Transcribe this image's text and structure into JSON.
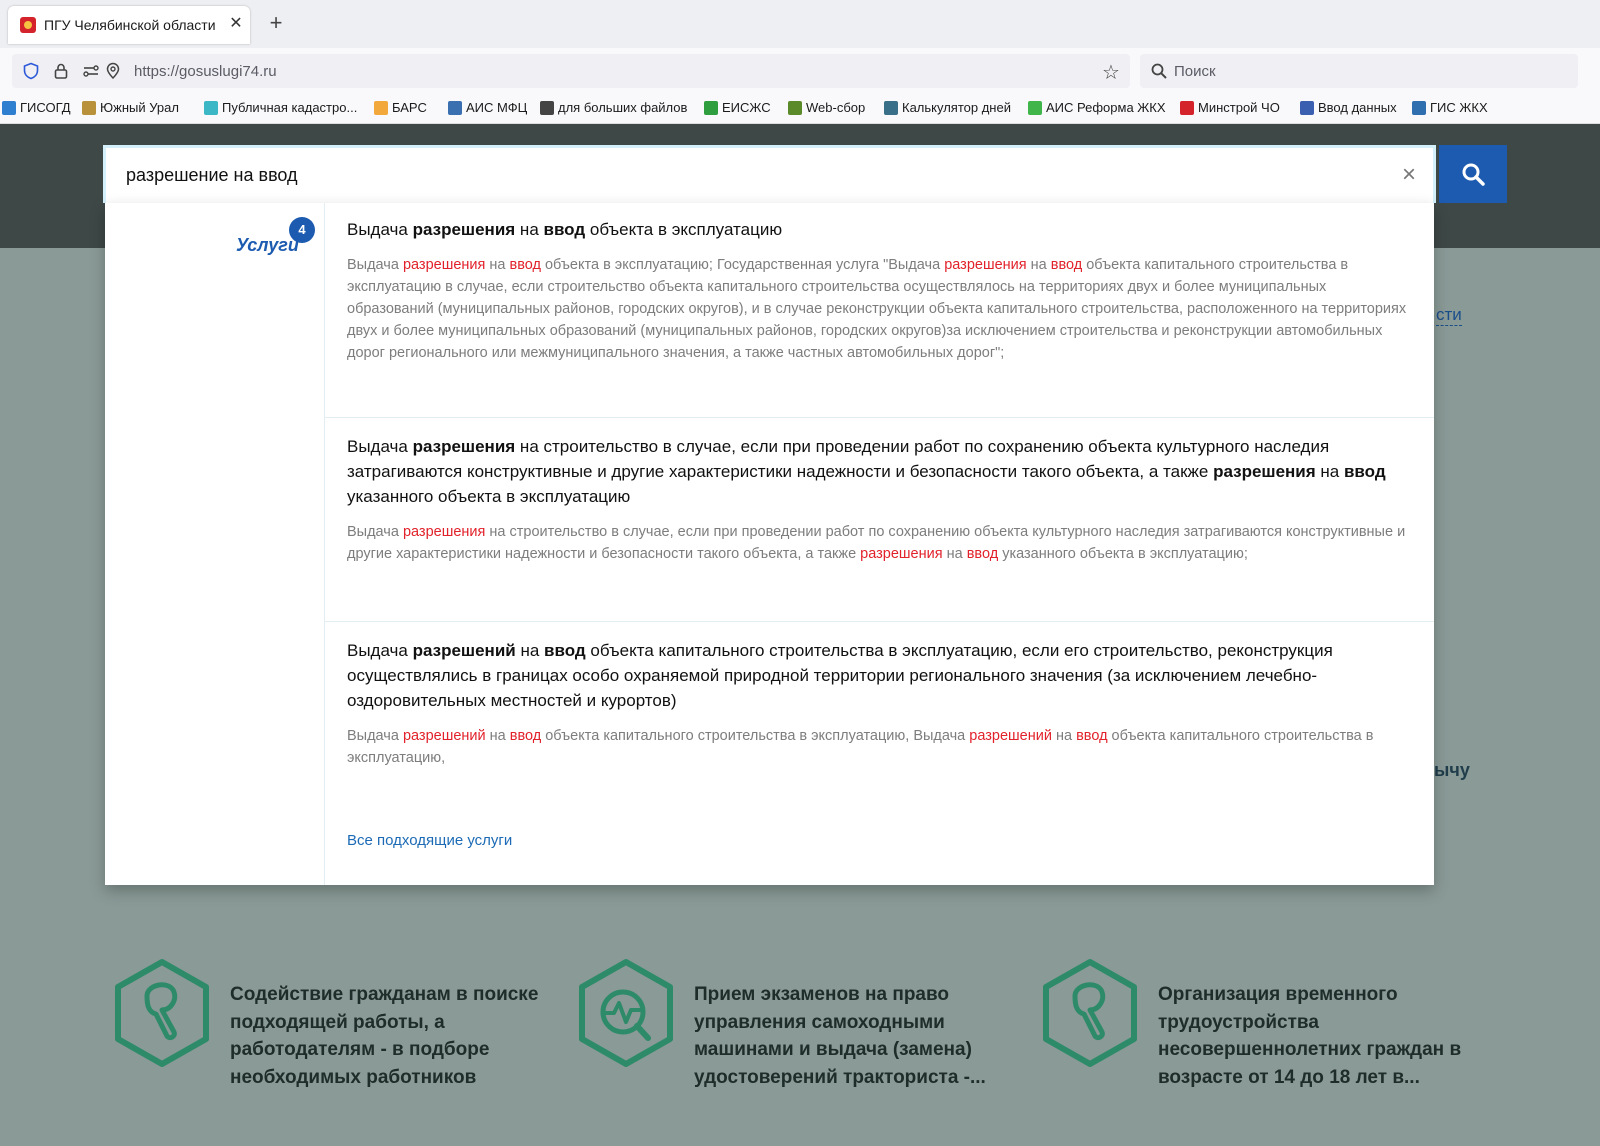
{
  "browser": {
    "tab_title": "ПГУ Челябинской области",
    "tab_close": "✕",
    "new_tab": "+",
    "url": "https://gosuslugi74.ru",
    "search_placeholder": "Поиск",
    "bookmarks": [
      {
        "label": "ГИСОГД",
        "color": "#2f7fd1"
      },
      {
        "label": "Южный Урал",
        "color": "#b8913a"
      },
      {
        "label": "Публичная кадастро...",
        "color": "#3bb7c6"
      },
      {
        "label": "БАРС",
        "color": "#f2a83b"
      },
      {
        "label": "АИС МФЦ",
        "color": "#3a6fb0"
      },
      {
        "label": "для больших файлов",
        "color": "#444444"
      },
      {
        "label": "ЕИСЖС",
        "color": "#2e9e3e"
      },
      {
        "label": "Web-сбор",
        "color": "#5b8a2b"
      },
      {
        "label": "Калькулятор дней",
        "color": "#3a6f8a"
      },
      {
        "label": "АИС Реформа ЖКХ",
        "color": "#3fb54a"
      },
      {
        "label": "Минстрой ЧО",
        "color": "#d4232b"
      },
      {
        "label": "Ввод данных",
        "color": "#3a5fb0"
      },
      {
        "label": "ГИС ЖКХ",
        "color": "#2f6fb0"
      }
    ]
  },
  "search": {
    "query": "разрешение на ввод",
    "clear_label": "×"
  },
  "dropdown": {
    "category": "Услуги",
    "count": "4",
    "all_link": "Все подходящие услуги",
    "results": [
      {
        "title": [
          {
            "t": "Выдача ",
            "b": false
          },
          {
            "t": "разрешения",
            "b": true
          },
          {
            "t": " на ",
            "b": false
          },
          {
            "t": "ввод",
            "b": true
          },
          {
            "t": " объекта в эксплуатацию",
            "b": false
          }
        ],
        "desc": [
          {
            "t": "Выдача ",
            "h": false
          },
          {
            "t": "разрешения",
            "h": true
          },
          {
            "t": " на ",
            "h": false
          },
          {
            "t": "ввод",
            "h": true
          },
          {
            "t": " объекта в эксплуатацию; Государственная услуга \"Выдача ",
            "h": false
          },
          {
            "t": "разрешения",
            "h": true
          },
          {
            "t": " на ",
            "h": false
          },
          {
            "t": "ввод",
            "h": true
          },
          {
            "t": " объекта капитального строительства в эксплуатацию в случае, если строительство объекта капитального строительства осуществлялось на территориях двух и более муниципальных образований (муниципальных районов, городских округов), и в случае реконструкции объекта капитального строительства, расположенного на территориях двух и более муниципальных образований (муниципальных районов, городских округов)за исключением строительства и реконструкции автомобильных дорог регионального или межмуниципального значения, а также частных автомобильных дорог\";",
            "h": false
          }
        ]
      },
      {
        "title": [
          {
            "t": "Выдача ",
            "b": false
          },
          {
            "t": "разрешения",
            "b": true
          },
          {
            "t": " на строительство в случае, если при проведении работ по сохранению объекта культурного наследия затрагиваются конструктивные и другие характеристики надежности и безопасности такого объекта, а также ",
            "b": false
          },
          {
            "t": "разрешения",
            "b": true
          },
          {
            "t": " на ",
            "b": false
          },
          {
            "t": "ввод",
            "b": true
          },
          {
            "t": " указанного объекта в эксплуатацию",
            "b": false
          }
        ],
        "desc": [
          {
            "t": "Выдача ",
            "h": false
          },
          {
            "t": "разрешения",
            "h": true
          },
          {
            "t": " на строительство в случае, если при проведении работ по сохранению объекта культурного наследия затрагиваются конструктивные и другие характеристики надежности и безопасности такого объекта, а также ",
            "h": false
          },
          {
            "t": "разрешения",
            "h": true
          },
          {
            "t": " на ",
            "h": false
          },
          {
            "t": "ввод",
            "h": true
          },
          {
            "t": " указанного объекта в эксплуатацию;",
            "h": false
          }
        ]
      },
      {
        "title": [
          {
            "t": "Выдача ",
            "b": false
          },
          {
            "t": "разрешений",
            "b": true
          },
          {
            "t": " на ",
            "b": false
          },
          {
            "t": "ввод",
            "b": true
          },
          {
            "t": " объекта капитального строительства в эксплуатацию, если его строительство, реконструкция осуществлялись в границах особо охраняемой природной территории регионального значения (за исключением лечебно-оздоровительных местностей и курортов)",
            "b": false
          }
        ],
        "desc": [
          {
            "t": "Выдача ",
            "h": false
          },
          {
            "t": "разрешений",
            "h": true
          },
          {
            "t": " на ",
            "h": false
          },
          {
            "t": "ввод",
            "h": true
          },
          {
            "t": " объекта капитального строительства в эксплуатацию, Выдача ",
            "h": false
          },
          {
            "t": "разрешений",
            "h": true
          },
          {
            "t": " на ",
            "h": false
          },
          {
            "t": "ввод",
            "h": true
          },
          {
            "t": " объекта капитального строительства в эксплуатацию,",
            "h": false
          }
        ]
      }
    ]
  },
  "background": {
    "fragment_link": "сти",
    "fragment_text": "ычу"
  },
  "cards": [
    {
      "text": "Содействие гражданам в поиске подходящей работы, а работодателям - в подборе необходимых работников",
      "icon": "shovel-icon"
    },
    {
      "text": "Прием экзаменов на право управления самоходными машинами и выдача (замена) удостоверений тракториста -...",
      "icon": "tractor-exam-icon"
    },
    {
      "text": "Организация временного трудоустройства несовершеннолетних граждан в возрасте от 14 до 18 лет в...",
      "icon": "shovel-icon"
    }
  ],
  "colors": {
    "accent": "#1c5bb0",
    "highlight": "#e2222b",
    "icon_green": "#2e8b6a"
  }
}
